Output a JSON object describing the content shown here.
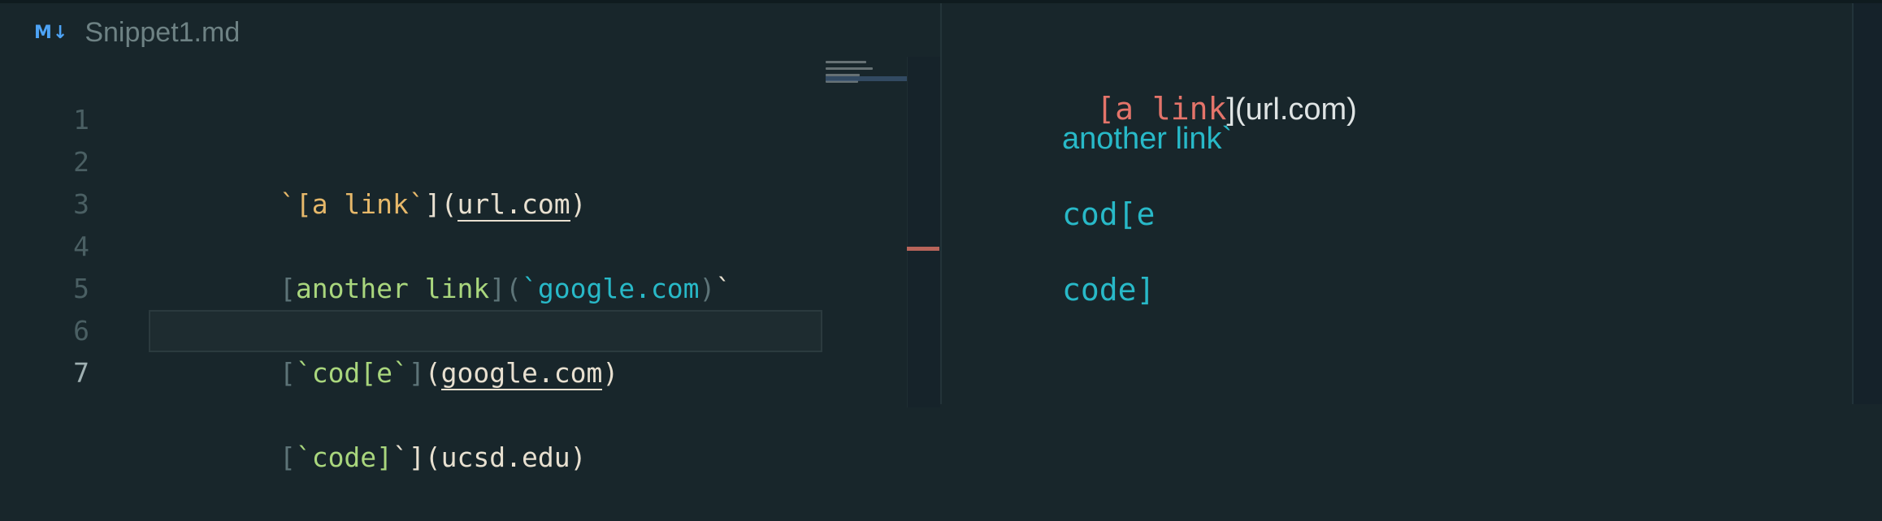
{
  "tab": {
    "icon": "markdown-icon",
    "icon_text": "M↓",
    "title": "Snippet1.md"
  },
  "editor": {
    "line_numbers": [
      "1",
      "2",
      "3",
      "4",
      "5",
      "6",
      "7"
    ],
    "lines": [
      {
        "t1": "`",
        "t2": "[a link",
        "t3": "`",
        "t4": "](",
        "t5": "url.com",
        "t6": ")"
      },
      {},
      {
        "t1": "[",
        "t2": "another link",
        "t3": "](",
        "t4": "`google.com",
        "t5": ")",
        "t6": "`"
      },
      {},
      {
        "t1": "[",
        "t2": "`cod[e`",
        "t3": "]",
        "t4": "(",
        "t5": "google.com",
        "t6": ")"
      },
      {},
      {
        "t1": "[",
        "t2": "`code]",
        "t3": "`](ucsd.edu)"
      }
    ]
  },
  "preview": {
    "line1": {
      "red": "[a link",
      "rest": "](url.com)"
    },
    "line2": "another link`",
    "line3": "cod[e",
    "line4": "code]"
  }
}
